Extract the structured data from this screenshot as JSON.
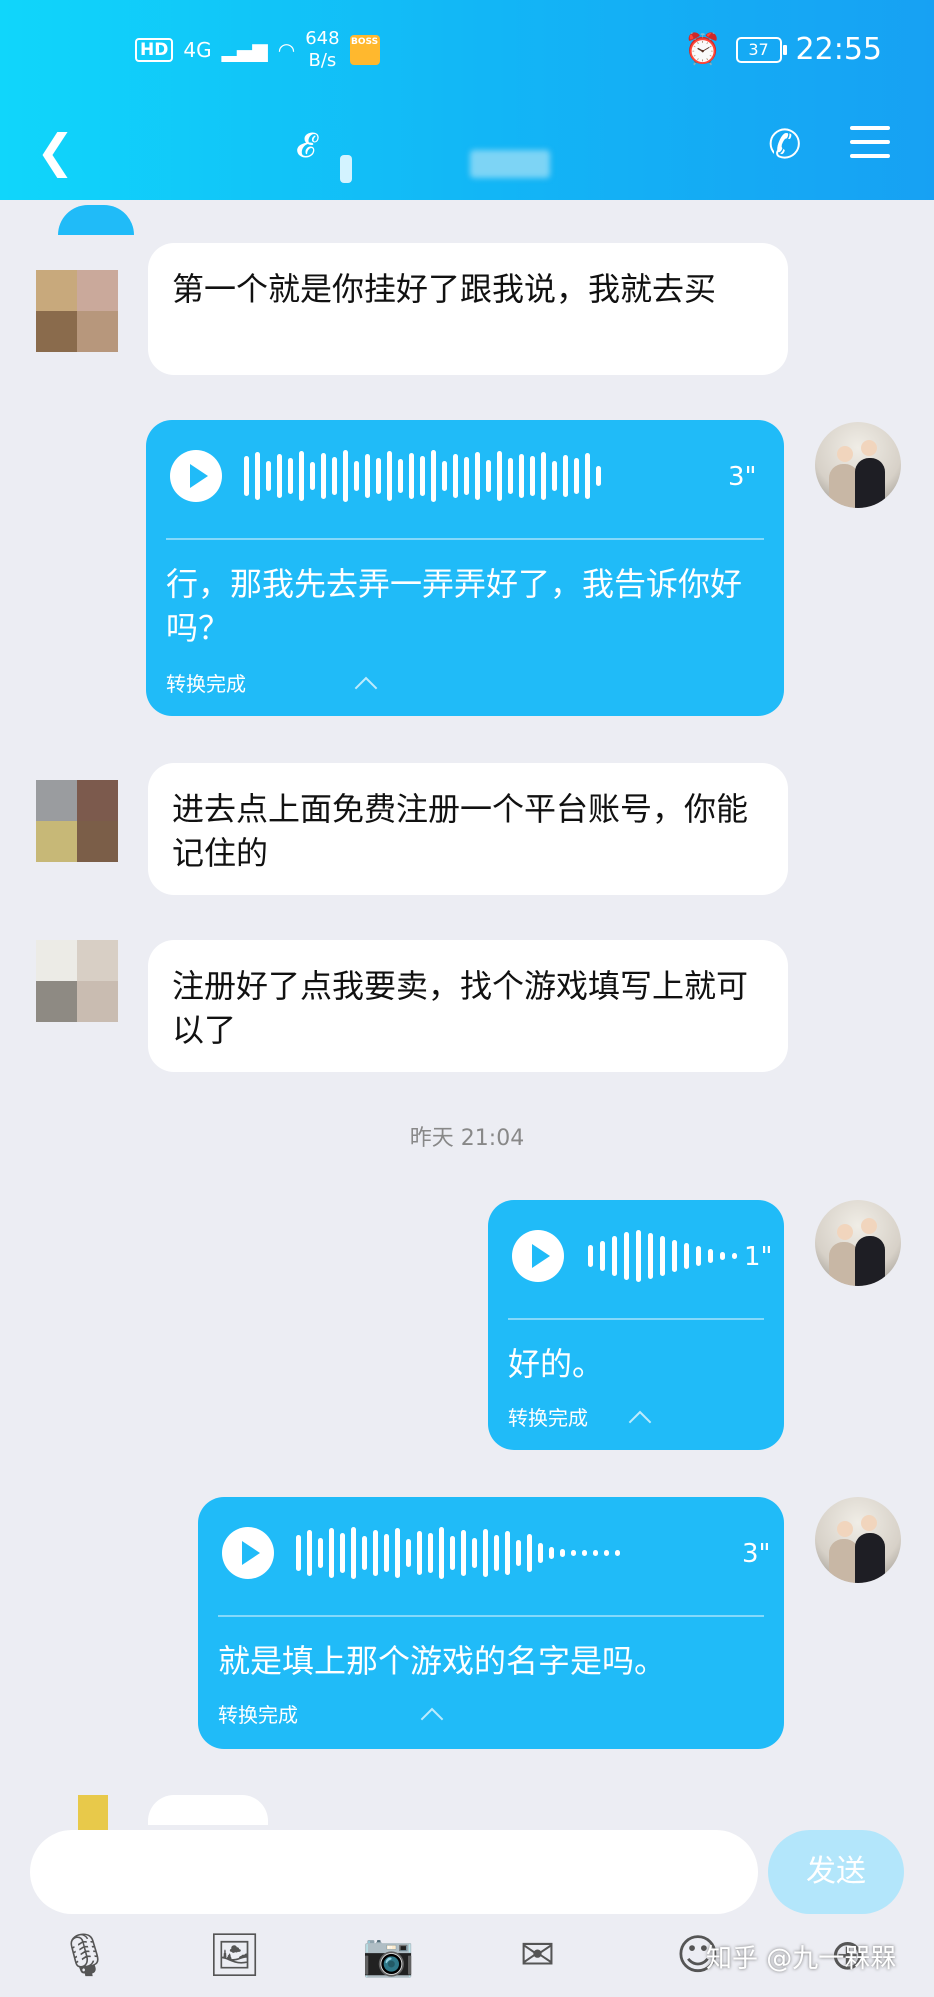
{
  "status_bar": {
    "hd": "HD",
    "network": "4G",
    "speed_value": "648",
    "speed_unit": "B/s",
    "battery": "37",
    "time": "22:55"
  },
  "header": {
    "back_icon": "chevron-left-icon",
    "ear_icon": "ear-icon",
    "phone_icon": "phone-icon",
    "menu_icon": "menu-icon"
  },
  "messages": [
    {
      "side": "left",
      "type": "text",
      "text": "第一个就是你挂好了跟我说，我就去买"
    },
    {
      "side": "right",
      "type": "voice",
      "duration": "3\"",
      "transcript": "行，那我先去弄一弄弄好了，我告诉你好吗？",
      "status": "转换完成"
    },
    {
      "side": "left",
      "type": "text",
      "text": "进去点上面免费注册一个平台账号，你能记住的"
    },
    {
      "side": "left",
      "type": "text",
      "text": "注册好了点我要卖，找个游戏填写上就可以了"
    },
    {
      "side": "center",
      "type": "timestamp",
      "text": "昨天 21:04"
    },
    {
      "side": "right",
      "type": "voice",
      "duration": "1\"",
      "transcript": "好的。",
      "status": "转换完成"
    },
    {
      "side": "right",
      "type": "voice",
      "duration": "3\"",
      "transcript": "就是填上那个游戏的名字是吗。",
      "status": "转换完成"
    }
  ],
  "composer": {
    "send_label": "发送",
    "tools": [
      "mic-icon",
      "image-icon",
      "camera-icon",
      "red-packet-icon",
      "emoji-icon",
      "plus-icon"
    ]
  },
  "watermark": "知乎 @九一槑槑"
}
